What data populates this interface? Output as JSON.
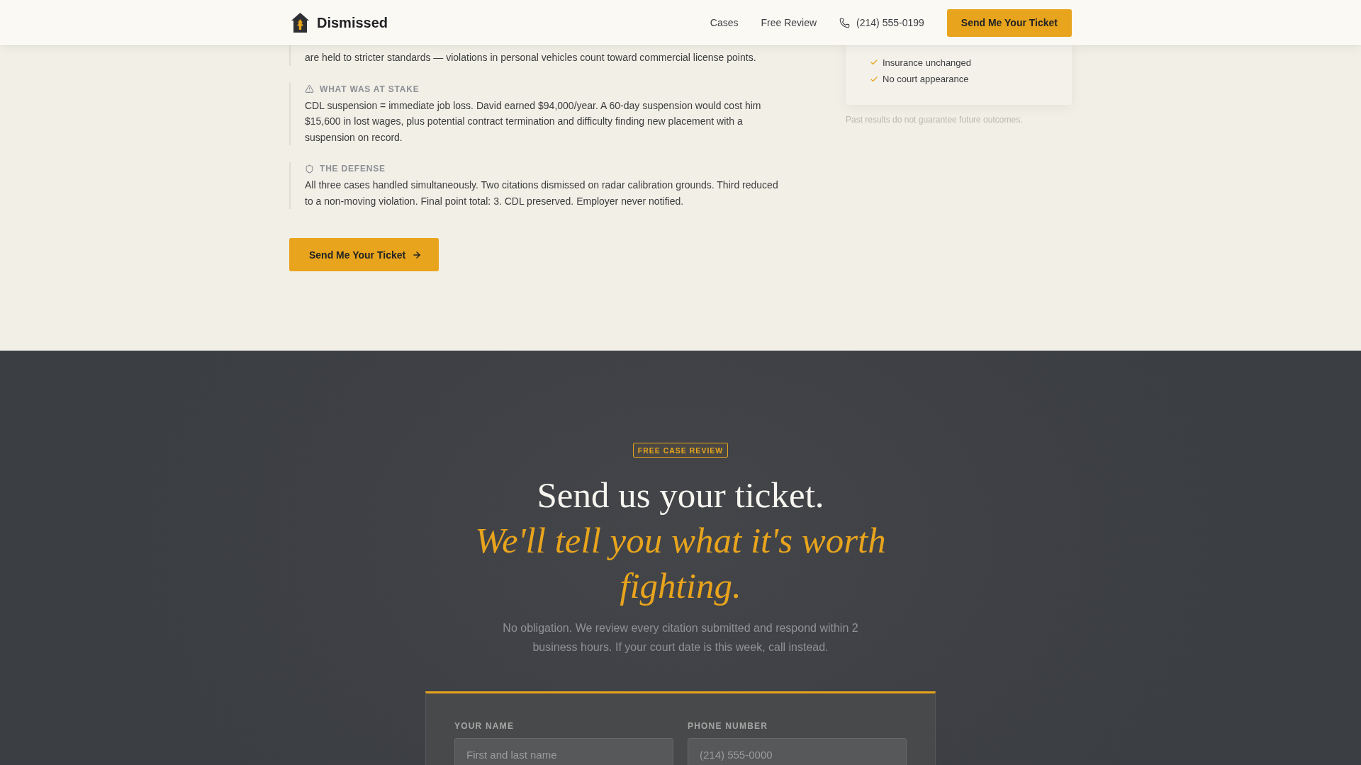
{
  "header": {
    "brand": "Dismissed",
    "nav": [
      {
        "label": "Cases"
      },
      {
        "label": "Free Review"
      }
    ],
    "phone": "(214) 555-0199",
    "cta": "Send Me Your Ticket"
  },
  "case_study": {
    "sections": [
      {
        "kind": "text",
        "body": "are held to stricter standards — violations in personal vehicles count toward commercial license points."
      },
      {
        "kind": "warning",
        "heading": "WHAT WAS AT STAKE",
        "body": "CDL suspension = immediate job loss. David earned $94,000/year. A 60-day suspension would cost him $15,600 in lost wages, plus potential contract termination and difficulty finding new placement with a suspension on record."
      },
      {
        "kind": "shield",
        "heading": "THE DEFENSE",
        "body": "All three cases handled simultaneously. Two citations dismissed on radar calibration grounds. Third reduced to a non-moving violation. Final point total: 3. CDL preserved. Employer never notified."
      }
    ],
    "cta": "Send Me Your Ticket"
  },
  "outcome_card": {
    "items": [
      "Insurance unchanged",
      "No court appearance"
    ],
    "disclaimer": "Past results do not guarantee future outcomes."
  },
  "review": {
    "badge": "FREE CASE REVIEW",
    "title": "Send us your ticket.",
    "title_accent": "We'll tell you what it's worth fighting.",
    "subtitle": "No obligation. We review every citation submitted and respond within 2 business hours. If your court date is this week, call instead.",
    "form": {
      "fields": [
        {
          "label": "YOUR NAME",
          "placeholder": "First and last name"
        },
        {
          "label": "PHONE NUMBER",
          "placeholder": "(214) 555-0000"
        }
      ]
    }
  }
}
